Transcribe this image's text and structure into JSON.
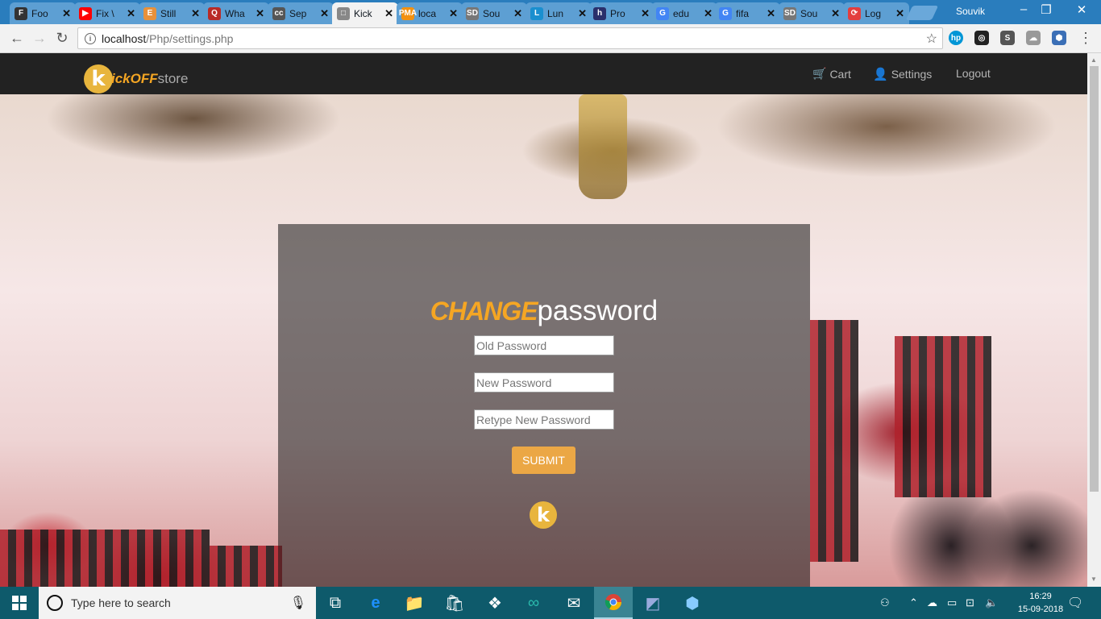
{
  "browser": {
    "tabs": [
      {
        "title": "Foo",
        "favicon": "F",
        "color": "#333333"
      },
      {
        "title": "Fix \\",
        "favicon": "▶",
        "color": "#ff0000"
      },
      {
        "title": "Still",
        "favicon": "E",
        "color": "#e8913a"
      },
      {
        "title": "Wha",
        "favicon": "Q",
        "color": "#b92b27"
      },
      {
        "title": "Sep",
        "favicon": "cc",
        "color": "#555555"
      },
      {
        "title": "Kick",
        "favicon": "□",
        "color": "#888888"
      },
      {
        "title": "loca",
        "favicon": "PMA",
        "color": "#f29111"
      },
      {
        "title": "Sou",
        "favicon": "SD",
        "color": "#777777"
      },
      {
        "title": "Lun",
        "favicon": "L",
        "color": "#1a8fcf"
      },
      {
        "title": "Pro",
        "favicon": "h",
        "color": "#2a2f6b"
      },
      {
        "title": "edu",
        "favicon": "G",
        "color": "#4285f4"
      },
      {
        "title": "fifa",
        "favicon": "G",
        "color": "#4285f4"
      },
      {
        "title": "Sou",
        "favicon": "SD",
        "color": "#777777"
      },
      {
        "title": "Log",
        "favicon": "⟳",
        "color": "#e33e3e"
      }
    ],
    "profile_name": "Souvik",
    "url_host": "localhost",
    "url_path": "/Php/settings.php"
  },
  "site": {
    "logo_letter": "k",
    "brand_kick": "ickOFF",
    "brand_store": "store",
    "nav": {
      "cart": "Cart",
      "settings": "Settings",
      "logout": "Logout"
    }
  },
  "form": {
    "heading_change": "CHANGE",
    "heading_password": "password",
    "old_placeholder": "Old Password",
    "new_placeholder": "New Password",
    "retype_placeholder": "Retype New Password",
    "submit_label": "SUBMIT"
  },
  "taskbar": {
    "search_placeholder": "Type here to search",
    "time": "16:29",
    "date": "15-09-2018"
  },
  "colors": {
    "accent": "#f5a623",
    "navbar": "#222222",
    "taskbar": "#0e5a6b"
  }
}
